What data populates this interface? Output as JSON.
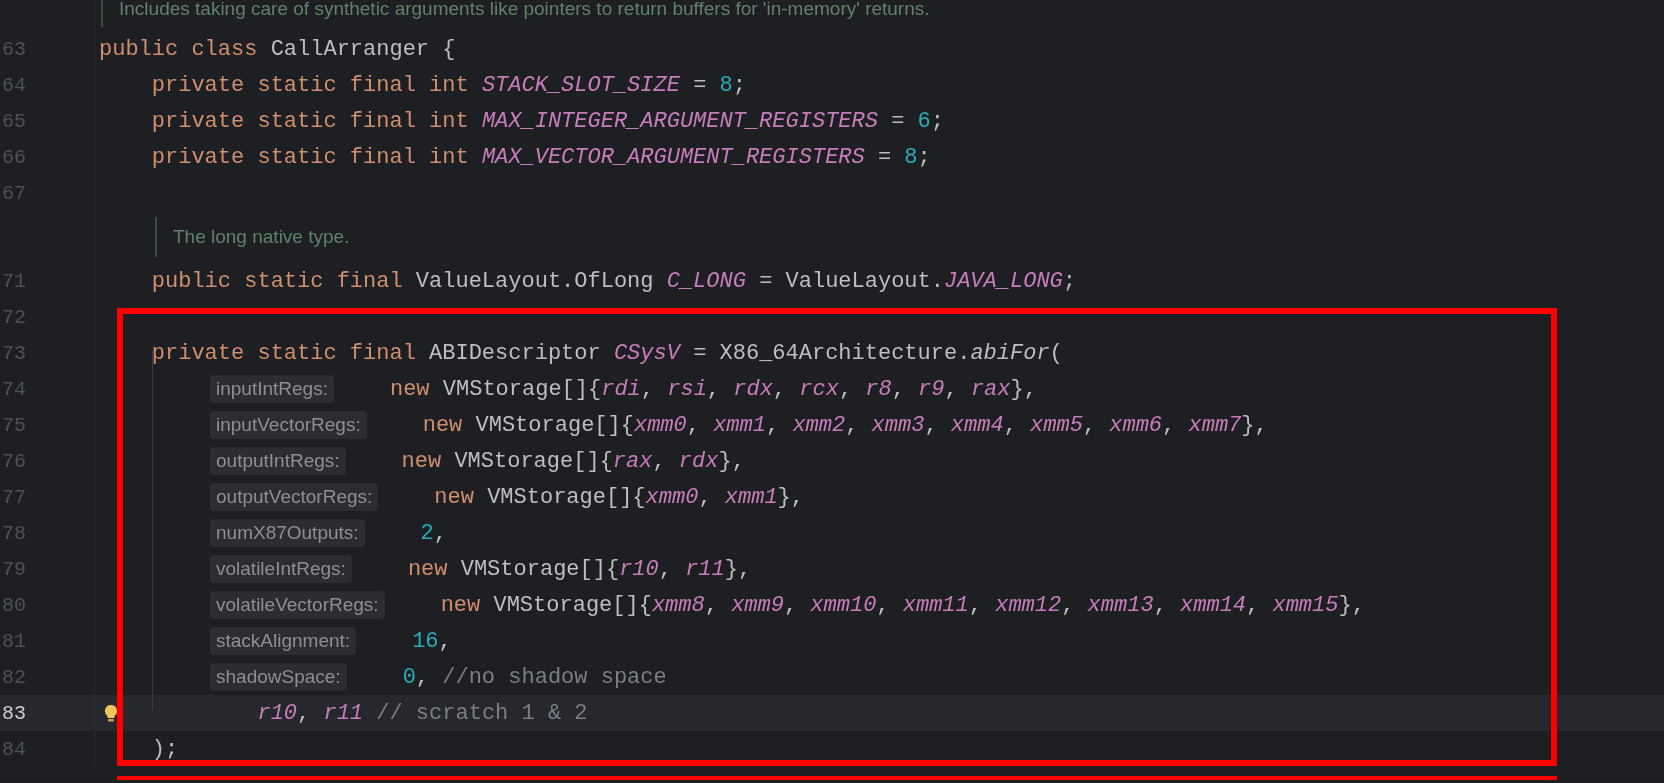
{
  "editor": {
    "lines": [
      {
        "kind": "doc",
        "text": "Includes taking care of synthetic arguments like pointers to return buffers for 'in-memory' returns."
      },
      {
        "kind": "code",
        "number": "63",
        "current": false,
        "tokens": [
          {
            "t": "public class ",
            "kind": "keyword"
          },
          {
            "t": "CallArranger {",
            "kind": "plain"
          }
        ]
      },
      {
        "kind": "code",
        "number": "64",
        "current": false,
        "tokens": [
          {
            "t": "    private static final int ",
            "kind": "keyword"
          },
          {
            "t": "STACK_SLOT_SIZE",
            "kind": "constant"
          },
          {
            "t": " = ",
            "kind": "plain"
          },
          {
            "t": "8",
            "kind": "number"
          },
          {
            "t": ";",
            "kind": "plain"
          }
        ]
      },
      {
        "kind": "code",
        "number": "65",
        "current": false,
        "tokens": [
          {
            "t": "    private static final int ",
            "kind": "keyword"
          },
          {
            "t": "MAX_INTEGER_ARGUMENT_REGISTERS",
            "kind": "constant"
          },
          {
            "t": " = ",
            "kind": "plain"
          },
          {
            "t": "6",
            "kind": "number"
          },
          {
            "t": ";",
            "kind": "plain"
          }
        ]
      },
      {
        "kind": "code",
        "number": "66",
        "current": false,
        "tokens": [
          {
            "t": "    private static final int ",
            "kind": "keyword"
          },
          {
            "t": "MAX_VECTOR_ARGUMENT_REGISTERS",
            "kind": "constant"
          },
          {
            "t": " = ",
            "kind": "plain"
          },
          {
            "t": "8",
            "kind": "number"
          },
          {
            "t": ";",
            "kind": "plain"
          }
        ]
      },
      {
        "kind": "code",
        "number": "67",
        "current": false
      },
      {
        "kind": "doc",
        "text": "The long native type."
      },
      {
        "kind": "code",
        "number": "71",
        "current": false,
        "tokens": [
          {
            "t": "    public static final ",
            "kind": "keyword"
          },
          {
            "t": "ValueLayout.OfLong ",
            "kind": "plain"
          },
          {
            "t": "C_LONG",
            "kind": "constant"
          },
          {
            "t": " = ValueLayout.",
            "kind": "plain"
          },
          {
            "t": "JAVA_LONG",
            "kind": "constant"
          },
          {
            "t": ";",
            "kind": "plain"
          }
        ]
      },
      {
        "kind": "code",
        "number": "72",
        "current": false
      },
      {
        "kind": "code",
        "number": "73",
        "current": false,
        "tokens": [
          {
            "t": "    private static final ",
            "kind": "keyword"
          },
          {
            "t": "ABIDescriptor ",
            "kind": "plain"
          },
          {
            "t": "CSysV",
            "kind": "constant"
          },
          {
            "t": " = X86_64Architecture.",
            "kind": "plain"
          },
          {
            "t": "abiFor",
            "kind": "method"
          },
          {
            "t": "(",
            "kind": "plain"
          }
        ]
      },
      {
        "kind": "code",
        "number": "74",
        "current": false,
        "hint": "inputIntRegs:",
        "tokens": [
          {
            "t": "new ",
            "kind": "keyword"
          },
          {
            "t": "VMStorage[]{",
            "kind": "plain"
          },
          {
            "t": "rdi",
            "kind": "constant"
          },
          {
            "t": ", ",
            "kind": "plain"
          },
          {
            "t": "rsi",
            "kind": "constant"
          },
          {
            "t": ", ",
            "kind": "plain"
          },
          {
            "t": "rdx",
            "kind": "constant"
          },
          {
            "t": ", ",
            "kind": "plain"
          },
          {
            "t": "rcx",
            "kind": "constant"
          },
          {
            "t": ", ",
            "kind": "plain"
          },
          {
            "t": "r8",
            "kind": "constant"
          },
          {
            "t": ", ",
            "kind": "plain"
          },
          {
            "t": "r9",
            "kind": "constant"
          },
          {
            "t": ", ",
            "kind": "plain"
          },
          {
            "t": "rax",
            "kind": "constant"
          },
          {
            "t": "},",
            "kind": "plain"
          }
        ]
      },
      {
        "kind": "code",
        "number": "75",
        "current": false,
        "hint": "inputVectorRegs:",
        "tokens": [
          {
            "t": "new ",
            "kind": "keyword"
          },
          {
            "t": "VMStorage[]{",
            "kind": "plain"
          },
          {
            "t": "xmm0",
            "kind": "constant"
          },
          {
            "t": ", ",
            "kind": "plain"
          },
          {
            "t": "xmm1",
            "kind": "constant"
          },
          {
            "t": ", ",
            "kind": "plain"
          },
          {
            "t": "xmm2",
            "kind": "constant"
          },
          {
            "t": ", ",
            "kind": "plain"
          },
          {
            "t": "xmm3",
            "kind": "constant"
          },
          {
            "t": ", ",
            "kind": "plain"
          },
          {
            "t": "xmm4",
            "kind": "constant"
          },
          {
            "t": ", ",
            "kind": "plain"
          },
          {
            "t": "xmm5",
            "kind": "constant"
          },
          {
            "t": ", ",
            "kind": "plain"
          },
          {
            "t": "xmm6",
            "kind": "constant"
          },
          {
            "t": ", ",
            "kind": "plain"
          },
          {
            "t": "xmm7",
            "kind": "constant"
          },
          {
            "t": "},",
            "kind": "plain"
          }
        ]
      },
      {
        "kind": "code",
        "number": "76",
        "current": false,
        "hint": "outputIntRegs:",
        "tokens": [
          {
            "t": "new ",
            "kind": "keyword"
          },
          {
            "t": "VMStorage[]{",
            "kind": "plain"
          },
          {
            "t": "rax",
            "kind": "constant"
          },
          {
            "t": ", ",
            "kind": "plain"
          },
          {
            "t": "rdx",
            "kind": "constant"
          },
          {
            "t": "},",
            "kind": "plain"
          }
        ]
      },
      {
        "kind": "code",
        "number": "77",
        "current": false,
        "hint": "outputVectorRegs:",
        "tokens": [
          {
            "t": "new ",
            "kind": "keyword"
          },
          {
            "t": "VMStorage[]{",
            "kind": "plain"
          },
          {
            "t": "xmm0",
            "kind": "constant"
          },
          {
            "t": ", ",
            "kind": "plain"
          },
          {
            "t": "xmm1",
            "kind": "constant"
          },
          {
            "t": "},",
            "kind": "plain"
          }
        ]
      },
      {
        "kind": "code",
        "number": "78",
        "current": false,
        "hint": "numX87Outputs:",
        "tokens": [
          {
            "t": "2",
            "kind": "number"
          },
          {
            "t": ",",
            "kind": "plain"
          }
        ]
      },
      {
        "kind": "code",
        "number": "79",
        "current": false,
        "hint": "volatileIntRegs:",
        "tokens": [
          {
            "t": "new ",
            "kind": "keyword"
          },
          {
            "t": "VMStorage[]{",
            "kind": "plain"
          },
          {
            "t": "r10",
            "kind": "constant"
          },
          {
            "t": ", ",
            "kind": "plain"
          },
          {
            "t": "r11",
            "kind": "constant"
          },
          {
            "t": "},",
            "kind": "plain"
          }
        ]
      },
      {
        "kind": "code",
        "number": "80",
        "current": false,
        "hint": "volatileVectorRegs:",
        "tokens": [
          {
            "t": "new ",
            "kind": "keyword"
          },
          {
            "t": "VMStorage[]{",
            "kind": "plain"
          },
          {
            "t": "xmm8",
            "kind": "constant"
          },
          {
            "t": ", ",
            "kind": "plain"
          },
          {
            "t": "xmm9",
            "kind": "constant"
          },
          {
            "t": ", ",
            "kind": "plain"
          },
          {
            "t": "xmm10",
            "kind": "constant"
          },
          {
            "t": ", ",
            "kind": "plain"
          },
          {
            "t": "xmm11",
            "kind": "constant"
          },
          {
            "t": ", ",
            "kind": "plain"
          },
          {
            "t": "xmm12",
            "kind": "constant"
          },
          {
            "t": ", ",
            "kind": "plain"
          },
          {
            "t": "xmm13",
            "kind": "constant"
          },
          {
            "t": ", ",
            "kind": "plain"
          },
          {
            "t": "xmm14",
            "kind": "constant"
          },
          {
            "t": ", ",
            "kind": "plain"
          },
          {
            "t": "xmm15",
            "kind": "constant"
          },
          {
            "t": "},",
            "kind": "plain"
          }
        ]
      },
      {
        "kind": "code",
        "number": "81",
        "current": false,
        "hint": "stackAlignment:",
        "tokens": [
          {
            "t": "16",
            "kind": "number"
          },
          {
            "t": ",",
            "kind": "plain"
          }
        ]
      },
      {
        "kind": "code",
        "number": "82",
        "current": false,
        "hint": "shadowSpace:",
        "tokens": [
          {
            "t": "0",
            "kind": "number"
          },
          {
            "t": ", ",
            "kind": "plain"
          },
          {
            "t": "//no shadow space",
            "kind": "comment"
          }
        ]
      },
      {
        "kind": "code",
        "number": "83",
        "current": true,
        "bulb": true,
        "tokens": [
          {
            "t": "            r10",
            "kind": "constant"
          },
          {
            "t": ", ",
            "kind": "plain"
          },
          {
            "t": "r11",
            "kind": "constant"
          },
          {
            "t": " // scratch 1 & 2",
            "kind": "comment"
          }
        ]
      },
      {
        "kind": "code",
        "number": "84",
        "current": false,
        "tokens": [
          {
            "t": "    );",
            "kind": "plain"
          }
        ]
      }
    ]
  }
}
